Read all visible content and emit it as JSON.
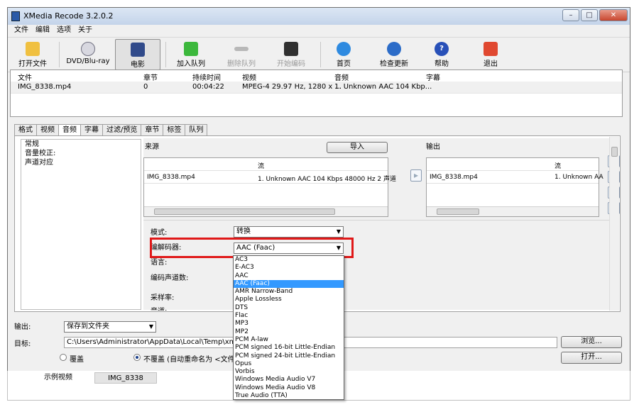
{
  "window": {
    "title": "XMedia Recode 3.2.0.2"
  },
  "menu": [
    "文件",
    "编辑",
    "选项",
    "关于"
  ],
  "toolbar": {
    "open_file": "打开文件",
    "dvd": "DVD/Blu-ray",
    "movie": "电影",
    "add_queue": "加入队列",
    "remove_queue": "删除队列",
    "start_encode": "开始编码",
    "home": "首页",
    "check_update": "检查更新",
    "help": "帮助",
    "exit": "退出"
  },
  "file_grid": {
    "headers": [
      "文件",
      "章节",
      "持续时间",
      "视频",
      "音频",
      "字幕"
    ],
    "row": [
      "IMG_8338.mp4",
      "0",
      "00:04:22",
      "MPEG-4 29.97 Hz, 1280 x ...",
      "1. Unknown AAC  104 Kbp...",
      ""
    ]
  },
  "tabs": [
    "格式",
    "视频",
    "音频",
    "字幕",
    "过滤/预览",
    "章节",
    "标签",
    "队列"
  ],
  "selected_tab": "音频",
  "left_list": [
    "常规",
    "音量校正:",
    "声道对应"
  ],
  "source": {
    "label": "来源",
    "import_button": "导入",
    "col_stream": "流",
    "row_file": "IMG_8338.mp4",
    "row_stream": "1. Unknown AAC  104 Kbps 48000 Hz 2 声道"
  },
  "output": {
    "label": "输出",
    "col_stream": "流",
    "row_file": "IMG_8338.mp4",
    "row_stream": "1. Unknown AA"
  },
  "settings": {
    "mode_label": "模式:",
    "mode_value": "转换",
    "encoder_label": "编解码器:",
    "encoder_value": "AAC (Faac)",
    "lang_label": "语言:",
    "channel_label": "编码声道数:",
    "samplerate_label": "采样率:",
    "more_label": "音道:"
  },
  "encoder_options": [
    "AC3",
    "E-AC3",
    "AAC",
    "AAC (Faac)",
    "AMR Narrow-Band",
    "Apple Lossless",
    "DTS",
    "Flac",
    "MP3",
    "MP2",
    "PCM A-law",
    "PCM signed 16-bit Little-Endian",
    "PCM signed 24-bit Little-Endian",
    "Opus",
    "Vorbis",
    "Windows Media Audio V7",
    "Windows Media Audio V8",
    "True Audio (TTA)"
  ],
  "highlighted_option": "AAC (Faac)",
  "output_bar": {
    "output_label": "输出:",
    "output_value": "保存到文件夹",
    "target_label": "目标:",
    "target_path": "C:\\Users\\Administrator\\AppData\\Local\\Temp\\xmr",
    "browse": "浏览...",
    "open": "打开...",
    "overwrite": "覆盖",
    "no_overwrite": "不覆盖 (自动重命名为 <文件"
  },
  "bottom_tabs": [
    "示例视频",
    "IMG_8338"
  ],
  "colors": {
    "highlight": "#3399ff",
    "callout": "#e01818"
  }
}
